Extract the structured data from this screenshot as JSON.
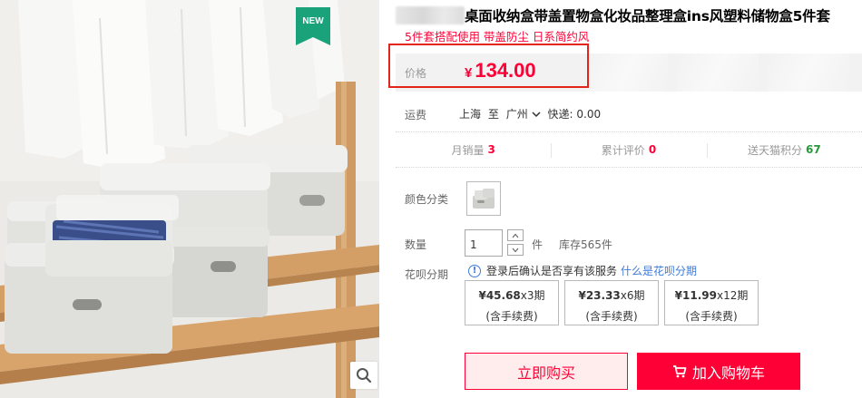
{
  "badge": {
    "label": "NEW"
  },
  "title": {
    "text": "桌面收纳盒带盖置物盒化妆品整理盒ins风塑料储物盒5件套"
  },
  "subtitle": "5件套搭配使用 带盖防尘 日系简约风",
  "price": {
    "label": "价格",
    "currency": "¥",
    "value": "134.00"
  },
  "shipping": {
    "label": "运费",
    "from": "上海",
    "to_word": "至",
    "to": "广州",
    "method": "快递: 0.00"
  },
  "stats": [
    {
      "label": "月销量",
      "value": "3",
      "color": "#ff0036"
    },
    {
      "label": "累计评价",
      "value": "0",
      "color": "#ff0036"
    },
    {
      "label": "送天猫积分",
      "value": "67",
      "color": "#279b39"
    }
  ],
  "color": {
    "label": "颜色分类"
  },
  "quantity": {
    "label": "数量",
    "value": "1",
    "unit": "件",
    "stock": "库存565件"
  },
  "huabei": {
    "label": "花呗分期",
    "note": "登录后确认是否享有该服务",
    "link": "什么是花呗分期",
    "plans": [
      {
        "amount": "¥45.68",
        "periods": "x3期",
        "fee": "(含手续费)"
      },
      {
        "amount": "¥23.33",
        "periods": "x6期",
        "fee": "(含手续费)"
      },
      {
        "amount": "¥11.99",
        "periods": "x12期",
        "fee": "(含手续费)"
      }
    ]
  },
  "actions": {
    "buy_now": "立即购买",
    "add_to_cart": "加入购物车"
  },
  "colors": {
    "accent": "#ff0036",
    "highlight_frame": "#e1251b",
    "link": "#3e7bd9",
    "points": "#279b39",
    "badge": "#1aa37a"
  }
}
